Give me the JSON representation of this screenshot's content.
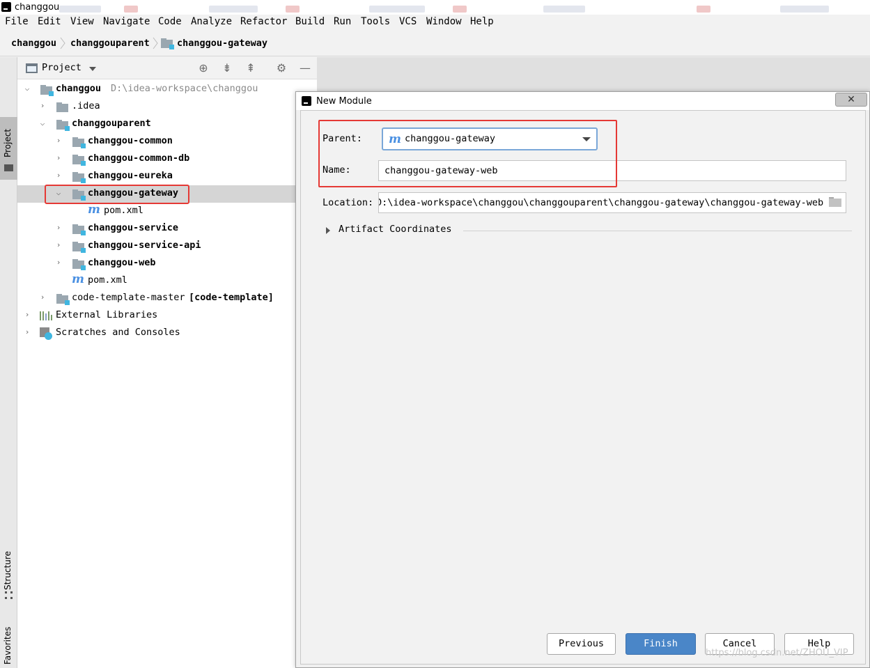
{
  "window": {
    "title": "changgou"
  },
  "menu": [
    "File",
    "Edit",
    "View",
    "Navigate",
    "Code",
    "Analyze",
    "Refactor",
    "Build",
    "Run",
    "Tools",
    "VCS",
    "Window",
    "Help"
  ],
  "breadcrumb": [
    "changgou",
    "changgouparent",
    "changgou-gateway"
  ],
  "left_strip": {
    "project_tab": "Project",
    "structure_tab": "Structure",
    "favorites_tab": "Favorites"
  },
  "project_panel": {
    "header": "Project",
    "tree": [
      {
        "label": "changgou",
        "path": "D:\\idea-workspace\\changgou"
      },
      {
        "label": ".idea"
      },
      {
        "label": "changgouparent"
      },
      {
        "label": "changgou-common"
      },
      {
        "label": "changgou-common-db"
      },
      {
        "label": "changgou-eureka"
      },
      {
        "label": "changgou-gateway"
      },
      {
        "label": "pom.xml"
      },
      {
        "label": "changgou-service"
      },
      {
        "label": "changgou-service-api"
      },
      {
        "label": "changgou-web"
      },
      {
        "label": "pom.xml"
      },
      {
        "label": "code-template-master",
        "suffix": "[code-template]"
      },
      {
        "label": "External Libraries"
      },
      {
        "label": "Scratches and Consoles"
      }
    ]
  },
  "dialog": {
    "title": "New Module",
    "close": "✕",
    "parent_label": "Parent:",
    "parent_value": "changgou-gateway",
    "maven_glyph": "m",
    "name_label": "Name:",
    "name_value": "changgou-gateway-web",
    "location_label": "Location:",
    "location_value": "D:\\idea-workspace\\changgou\\changgouparent\\changgou-gateway\\changgou-gateway-web",
    "artifact_label": "Artifact Coordinates",
    "buttons": {
      "previous": "Previous",
      "finish": "Finish",
      "cancel": "Cancel",
      "help": "Help"
    }
  },
  "watermark": "https://blog.csdn.net/ZHOU_VIP",
  "colors": {
    "highlight_red": "#e53935",
    "primary_button": "#4a86c8",
    "selection": "#d5d5d5"
  }
}
